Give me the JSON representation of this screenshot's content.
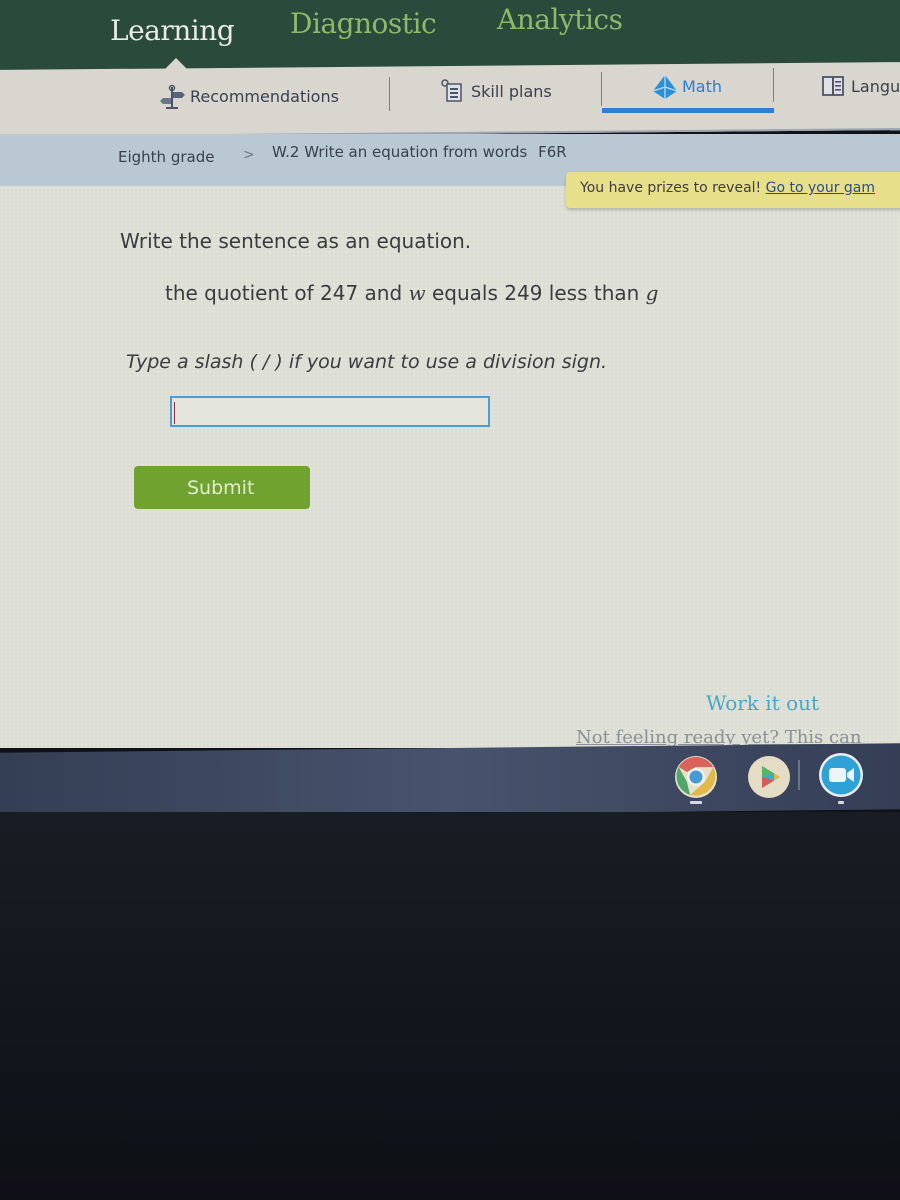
{
  "topnav": {
    "tabs": [
      {
        "label": "Learning",
        "active": true
      },
      {
        "label": "Diagnostic",
        "active": false
      },
      {
        "label": "Analytics",
        "active": false
      }
    ]
  },
  "subnav": {
    "items": [
      {
        "label": "Recommendations",
        "icon": "signpost-icon",
        "active": false
      },
      {
        "label": "Skill plans",
        "icon": "clipboard-icon",
        "active": false
      },
      {
        "label": "Math",
        "icon": "pyramid-icon",
        "active": true
      },
      {
        "label": "Langu",
        "icon": "book-icon",
        "active": false
      }
    ]
  },
  "breadcrumb": {
    "grade": "Eighth grade",
    "separator": ">",
    "skill": "W.2 Write an equation from words",
    "code": "F6R"
  },
  "prize_banner": {
    "text": "You have prizes to reveal!",
    "link": "Go to your gam"
  },
  "question": {
    "prompt": "Write the sentence as an equation.",
    "sentence_parts": [
      "the quotient of 247 and ",
      "w",
      " equals 249 less than ",
      "g"
    ],
    "hint": "Type a slash ( / ) if you want to use a division sign.",
    "answer_value": "",
    "submit_label": "Submit"
  },
  "help": {
    "work_it_out": "Work it out",
    "not_ready": "Not feeling ready yet? This can"
  },
  "shelf": {
    "apps": [
      {
        "name": "Chrome",
        "icon": "chrome-icon",
        "open": true
      },
      {
        "name": "Play Store",
        "icon": "play-store-icon",
        "open": false
      },
      {
        "name": "Zoom",
        "icon": "zoom-video-icon",
        "open": true
      }
    ]
  },
  "colors": {
    "nav_green": "#2a4a3c",
    "active_blue": "#2f7fd6",
    "submit_green": "#6fa22e",
    "prize_yellow": "#e8df8a"
  }
}
